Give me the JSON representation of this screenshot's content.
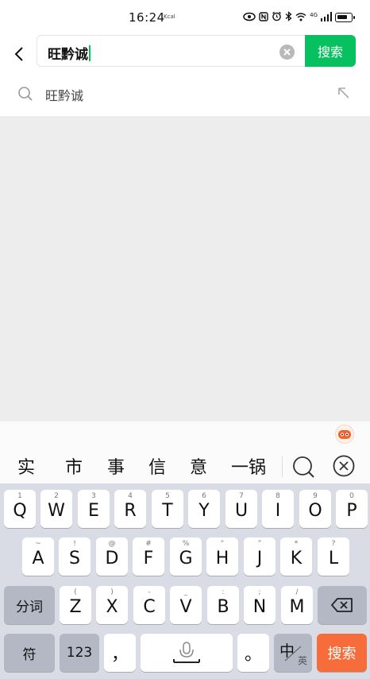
{
  "status_bar": {
    "time": "16:24",
    "time_sub": "Kcal",
    "icons": [
      "eye-icon",
      "nfc-icon",
      "alarm-icon",
      "bluetooth-icon",
      "wifi-icon",
      "signal-icon",
      "battery-icon"
    ],
    "network": "4G"
  },
  "search": {
    "query": "旺黔诚",
    "button_label": "搜索"
  },
  "suggestion": {
    "text": "旺黔诚"
  },
  "candidates": [
    "实",
    "市",
    "事",
    "信",
    "意",
    "一锅"
  ],
  "keyboard": {
    "row1": [
      {
        "hint": "1",
        "label": "Q"
      },
      {
        "hint": "2",
        "label": "W"
      },
      {
        "hint": "3",
        "label": "E"
      },
      {
        "hint": "4",
        "label": "R"
      },
      {
        "hint": "5",
        "label": "T"
      },
      {
        "hint": "6",
        "label": "Y"
      },
      {
        "hint": "7",
        "label": "U"
      },
      {
        "hint": "8",
        "label": "I"
      },
      {
        "hint": "9",
        "label": "O"
      },
      {
        "hint": "0",
        "label": "P"
      }
    ],
    "row2": [
      {
        "hint": "~",
        "label": "A"
      },
      {
        "hint": "!",
        "label": "S"
      },
      {
        "hint": "@",
        "label": "D"
      },
      {
        "hint": "#",
        "label": "F"
      },
      {
        "hint": "%",
        "label": "G"
      },
      {
        "hint": "“",
        "label": "H"
      },
      {
        "hint": "”",
        "label": "J"
      },
      {
        "hint": "*",
        "label": "K"
      },
      {
        "hint": "?",
        "label": "L"
      }
    ],
    "row3": [
      {
        "hint": "(",
        "label": "Z"
      },
      {
        "hint": ")",
        "label": "X"
      },
      {
        "hint": "-",
        "label": "C"
      },
      {
        "hint": "_",
        "label": "V"
      },
      {
        "hint": ":",
        "label": "B"
      },
      {
        "hint": ";",
        "label": "N"
      },
      {
        "hint": "/",
        "label": "M"
      }
    ],
    "segment_label": "分词",
    "symbol_label": "符",
    "number_label": "123",
    "comma": "，",
    "period": "。",
    "lang_main": "中",
    "lang_sub": "英",
    "enter_label": "搜索"
  },
  "colors": {
    "accent": "#07c160",
    "enter": "#f66d3b",
    "keyboard_bg": "#d9dce5",
    "content_bg": "#ededed"
  }
}
